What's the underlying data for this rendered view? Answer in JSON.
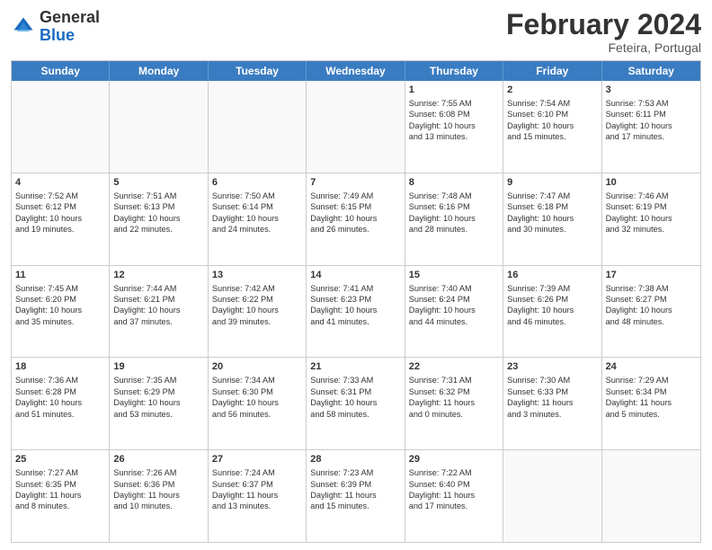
{
  "header": {
    "logo_line1": "General",
    "logo_line2": "Blue",
    "month_title": "February 2024",
    "subtitle": "Feteira, Portugal"
  },
  "days_of_week": [
    "Sunday",
    "Monday",
    "Tuesday",
    "Wednesday",
    "Thursday",
    "Friday",
    "Saturday"
  ],
  "rows": [
    [
      {
        "day": "",
        "info": "",
        "empty": true
      },
      {
        "day": "",
        "info": "",
        "empty": true
      },
      {
        "day": "",
        "info": "",
        "empty": true
      },
      {
        "day": "",
        "info": "",
        "empty": true
      },
      {
        "day": "1",
        "info": "Sunrise: 7:55 AM\nSunset: 6:08 PM\nDaylight: 10 hours\nand 13 minutes.",
        "empty": false
      },
      {
        "day": "2",
        "info": "Sunrise: 7:54 AM\nSunset: 6:10 PM\nDaylight: 10 hours\nand 15 minutes.",
        "empty": false
      },
      {
        "day": "3",
        "info": "Sunrise: 7:53 AM\nSunset: 6:11 PM\nDaylight: 10 hours\nand 17 minutes.",
        "empty": false
      }
    ],
    [
      {
        "day": "4",
        "info": "Sunrise: 7:52 AM\nSunset: 6:12 PM\nDaylight: 10 hours\nand 19 minutes.",
        "empty": false
      },
      {
        "day": "5",
        "info": "Sunrise: 7:51 AM\nSunset: 6:13 PM\nDaylight: 10 hours\nand 22 minutes.",
        "empty": false
      },
      {
        "day": "6",
        "info": "Sunrise: 7:50 AM\nSunset: 6:14 PM\nDaylight: 10 hours\nand 24 minutes.",
        "empty": false
      },
      {
        "day": "7",
        "info": "Sunrise: 7:49 AM\nSunset: 6:15 PM\nDaylight: 10 hours\nand 26 minutes.",
        "empty": false
      },
      {
        "day": "8",
        "info": "Sunrise: 7:48 AM\nSunset: 6:16 PM\nDaylight: 10 hours\nand 28 minutes.",
        "empty": false
      },
      {
        "day": "9",
        "info": "Sunrise: 7:47 AM\nSunset: 6:18 PM\nDaylight: 10 hours\nand 30 minutes.",
        "empty": false
      },
      {
        "day": "10",
        "info": "Sunrise: 7:46 AM\nSunset: 6:19 PM\nDaylight: 10 hours\nand 32 minutes.",
        "empty": false
      }
    ],
    [
      {
        "day": "11",
        "info": "Sunrise: 7:45 AM\nSunset: 6:20 PM\nDaylight: 10 hours\nand 35 minutes.",
        "empty": false
      },
      {
        "day": "12",
        "info": "Sunrise: 7:44 AM\nSunset: 6:21 PM\nDaylight: 10 hours\nand 37 minutes.",
        "empty": false
      },
      {
        "day": "13",
        "info": "Sunrise: 7:42 AM\nSunset: 6:22 PM\nDaylight: 10 hours\nand 39 minutes.",
        "empty": false
      },
      {
        "day": "14",
        "info": "Sunrise: 7:41 AM\nSunset: 6:23 PM\nDaylight: 10 hours\nand 41 minutes.",
        "empty": false
      },
      {
        "day": "15",
        "info": "Sunrise: 7:40 AM\nSunset: 6:24 PM\nDaylight: 10 hours\nand 44 minutes.",
        "empty": false
      },
      {
        "day": "16",
        "info": "Sunrise: 7:39 AM\nSunset: 6:26 PM\nDaylight: 10 hours\nand 46 minutes.",
        "empty": false
      },
      {
        "day": "17",
        "info": "Sunrise: 7:38 AM\nSunset: 6:27 PM\nDaylight: 10 hours\nand 48 minutes.",
        "empty": false
      }
    ],
    [
      {
        "day": "18",
        "info": "Sunrise: 7:36 AM\nSunset: 6:28 PM\nDaylight: 10 hours\nand 51 minutes.",
        "empty": false
      },
      {
        "day": "19",
        "info": "Sunrise: 7:35 AM\nSunset: 6:29 PM\nDaylight: 10 hours\nand 53 minutes.",
        "empty": false
      },
      {
        "day": "20",
        "info": "Sunrise: 7:34 AM\nSunset: 6:30 PM\nDaylight: 10 hours\nand 56 minutes.",
        "empty": false
      },
      {
        "day": "21",
        "info": "Sunrise: 7:33 AM\nSunset: 6:31 PM\nDaylight: 10 hours\nand 58 minutes.",
        "empty": false
      },
      {
        "day": "22",
        "info": "Sunrise: 7:31 AM\nSunset: 6:32 PM\nDaylight: 11 hours\nand 0 minutes.",
        "empty": false
      },
      {
        "day": "23",
        "info": "Sunrise: 7:30 AM\nSunset: 6:33 PM\nDaylight: 11 hours\nand 3 minutes.",
        "empty": false
      },
      {
        "day": "24",
        "info": "Sunrise: 7:29 AM\nSunset: 6:34 PM\nDaylight: 11 hours\nand 5 minutes.",
        "empty": false
      }
    ],
    [
      {
        "day": "25",
        "info": "Sunrise: 7:27 AM\nSunset: 6:35 PM\nDaylight: 11 hours\nand 8 minutes.",
        "empty": false
      },
      {
        "day": "26",
        "info": "Sunrise: 7:26 AM\nSunset: 6:36 PM\nDaylight: 11 hours\nand 10 minutes.",
        "empty": false
      },
      {
        "day": "27",
        "info": "Sunrise: 7:24 AM\nSunset: 6:37 PM\nDaylight: 11 hours\nand 13 minutes.",
        "empty": false
      },
      {
        "day": "28",
        "info": "Sunrise: 7:23 AM\nSunset: 6:39 PM\nDaylight: 11 hours\nand 15 minutes.",
        "empty": false
      },
      {
        "day": "29",
        "info": "Sunrise: 7:22 AM\nSunset: 6:40 PM\nDaylight: 11 hours\nand 17 minutes.",
        "empty": false
      },
      {
        "day": "",
        "info": "",
        "empty": true
      },
      {
        "day": "",
        "info": "",
        "empty": true
      }
    ]
  ]
}
